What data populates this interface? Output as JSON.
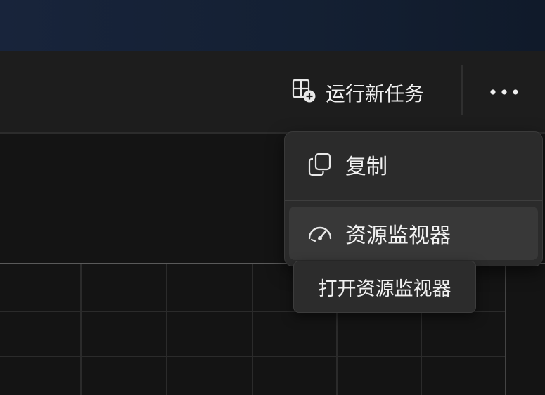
{
  "toolbar": {
    "run_new_task": {
      "label": "运行新任务",
      "icon": "add-window-icon"
    },
    "more": {
      "icon": "more-horizontal-icon"
    }
  },
  "context_menu": {
    "items": [
      {
        "label": "复制",
        "icon": "copy-icon"
      },
      {
        "label": "资源监视器",
        "icon": "gauge-icon",
        "hovered": true
      }
    ]
  },
  "tooltip": {
    "text": "打开资源监视器"
  },
  "colors": {
    "background": "#151515",
    "titlebar": "#1d1d1d",
    "menu": "#2b2b2b",
    "menu_hover": "#383838",
    "text": "#f0f0f0"
  }
}
